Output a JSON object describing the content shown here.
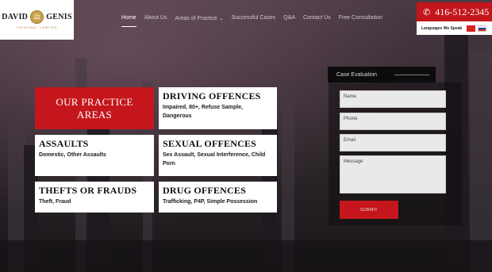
{
  "logo": {
    "first_name": "DAVID",
    "last_name": "GENIS",
    "tagline": "CRIMINAL LAWYER"
  },
  "nav": {
    "items": [
      {
        "label": "Home",
        "active": true
      },
      {
        "label": "About Us",
        "active": false
      },
      {
        "label": "Areas of Practice ⌄",
        "active": false
      },
      {
        "label": "Successful Cases",
        "active": false
      },
      {
        "label": "Q&A",
        "active": false
      },
      {
        "label": "Contact Us",
        "active": false
      },
      {
        "label": "Free Consultation",
        "active": false
      }
    ]
  },
  "contact": {
    "phone": "416-512-2345",
    "languages_label": "Languages We Speak"
  },
  "practice": {
    "title": "OUR PRACTICE\nAREAS",
    "cards": [
      {
        "title": "DRIVING OFFENCES",
        "desc": "Impaired, 80+, Refuse Sample, Dangerous"
      },
      {
        "title": "ASSAULTS",
        "desc": "Domestic, Other Assaults"
      },
      {
        "title": "SEXUAL OFFENCES",
        "desc": "Sex Assault, Sexual Interference, Child Porn"
      },
      {
        "title": "THEFTS OR FRAUDS",
        "desc": "Theft, Fraud"
      },
      {
        "title": "DRUG OFFENCES",
        "desc": "Trafficking, P4P, Simple Possession"
      }
    ]
  },
  "evaluation": {
    "title": "Case Evaluation",
    "name_placeholder": "Name",
    "phone_placeholder": "Phone",
    "email_placeholder": "Email",
    "message_placeholder": "Message",
    "submit_label": "SUBMIT"
  },
  "colors": {
    "brand_red": "#c4161c",
    "gold": "#c9a24a"
  }
}
